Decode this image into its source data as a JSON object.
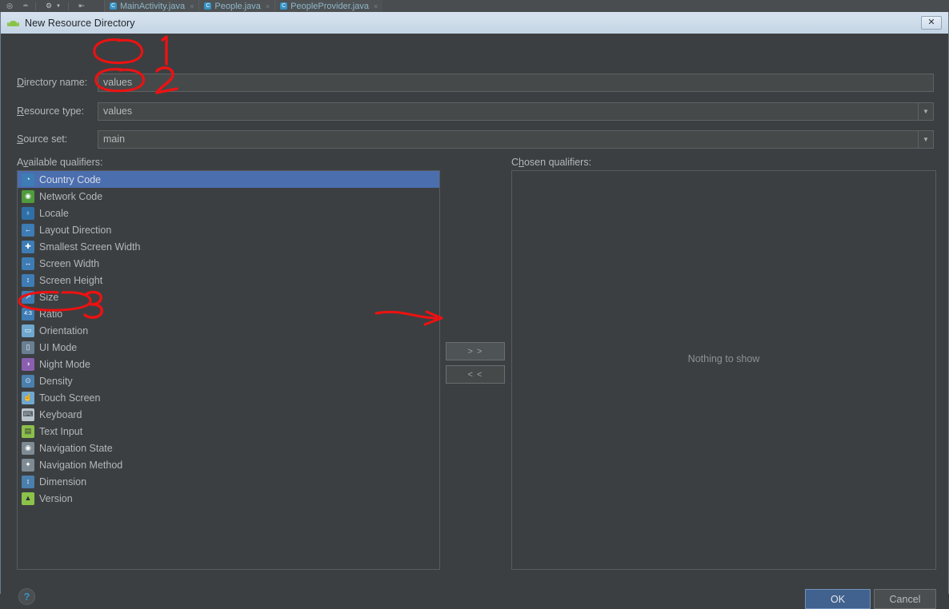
{
  "ide": {
    "toolbar_icons": [
      "target-icon",
      "hierarchy-icon",
      "gear-icon",
      "back-arrow-icon"
    ],
    "tabs": [
      {
        "label": "MainActivity.java",
        "icon": "java-class-icon",
        "close": "×"
      },
      {
        "label": "People.java",
        "icon": "java-class-icon",
        "close": "×"
      },
      {
        "label": "PeopleProvider.java",
        "icon": "java-class-icon",
        "close": "×"
      }
    ]
  },
  "dialog": {
    "title": "New Resource Directory",
    "title_icon": "android-robot-icon",
    "close_label": "✕",
    "fields": {
      "directory_name": {
        "label_prefix": "D",
        "label_rest": "irectory name:",
        "value": "values"
      },
      "resource_type": {
        "label_prefix": "R",
        "label_rest": "esource type:",
        "value": "values",
        "arrow": "▼"
      },
      "source_set": {
        "label_prefix": "S",
        "label_rest": "ource set:",
        "value": "main",
        "arrow": "▼"
      }
    },
    "available_panel": {
      "label_pre": "A",
      "label_mnemonic": "v",
      "label_post": "ailable qualifiers:",
      "items": [
        {
          "label": "Country Code",
          "icon": "country-code-icon",
          "selected": true
        },
        {
          "label": "Network Code",
          "icon": "network-code-icon",
          "selected": false
        },
        {
          "label": "Locale",
          "icon": "globe-icon",
          "selected": false
        },
        {
          "label": "Layout Direction",
          "icon": "layout-direction-icon",
          "selected": false
        },
        {
          "label": "Smallest Screen Width",
          "icon": "smallest-width-icon",
          "selected": false
        },
        {
          "label": "Screen Width",
          "icon": "screen-width-icon",
          "selected": false
        },
        {
          "label": "Screen Height",
          "icon": "screen-height-icon",
          "selected": false
        },
        {
          "label": "Size",
          "icon": "size-icon",
          "selected": false
        },
        {
          "label": "Ratio",
          "icon": "ratio-icon",
          "selected": false
        },
        {
          "label": "Orientation",
          "icon": "orientation-icon",
          "selected": false
        },
        {
          "label": "UI Mode",
          "icon": "ui-mode-icon",
          "selected": false
        },
        {
          "label": "Night Mode",
          "icon": "night-mode-icon",
          "selected": false
        },
        {
          "label": "Density",
          "icon": "density-icon",
          "selected": false
        },
        {
          "label": "Touch Screen",
          "icon": "touch-screen-icon",
          "selected": false
        },
        {
          "label": "Keyboard",
          "icon": "keyboard-icon",
          "selected": false
        },
        {
          "label": "Text Input",
          "icon": "text-input-icon",
          "selected": false
        },
        {
          "label": "Navigation State",
          "icon": "navigation-state-icon",
          "selected": false
        },
        {
          "label": "Navigation Method",
          "icon": "navigation-method-icon",
          "selected": false
        },
        {
          "label": "Dimension",
          "icon": "dimension-icon",
          "selected": false
        },
        {
          "label": "Version",
          "icon": "version-icon",
          "selected": false
        }
      ]
    },
    "chosen_panel": {
      "label_pre": "C",
      "label_mnemonic": "h",
      "label_post": "osen qualifiers:",
      "empty_text": "Nothing to show"
    },
    "transfer": {
      "move_right_label": "> >",
      "move_left_label": "< <"
    },
    "footer": {
      "help_label": "?",
      "ok_label": "OK",
      "cancel_label": "Cancel"
    }
  },
  "annotations": {
    "color": "#ee1111",
    "marks": [
      {
        "name": "circle-directory-name-value",
        "kind": "ellipse"
      },
      {
        "name": "numeral-1",
        "text": "1"
      },
      {
        "name": "circle-resource-type-value",
        "kind": "ellipse"
      },
      {
        "name": "numeral-2",
        "text": "2"
      },
      {
        "name": "circle-orientation-item",
        "kind": "ellipse"
      },
      {
        "name": "numeral-3",
        "text": "3"
      },
      {
        "name": "arrow-to-move-right-button",
        "kind": "arrow"
      }
    ]
  },
  "colors": {
    "dialog_background": "#3c3f41",
    "titlebar": "#cedcea",
    "selection_blue": "#4b6eaf",
    "ok_button_blue": "#41618e",
    "annotation_red": "#ee1111",
    "text_primary": "#b4b7ba"
  }
}
